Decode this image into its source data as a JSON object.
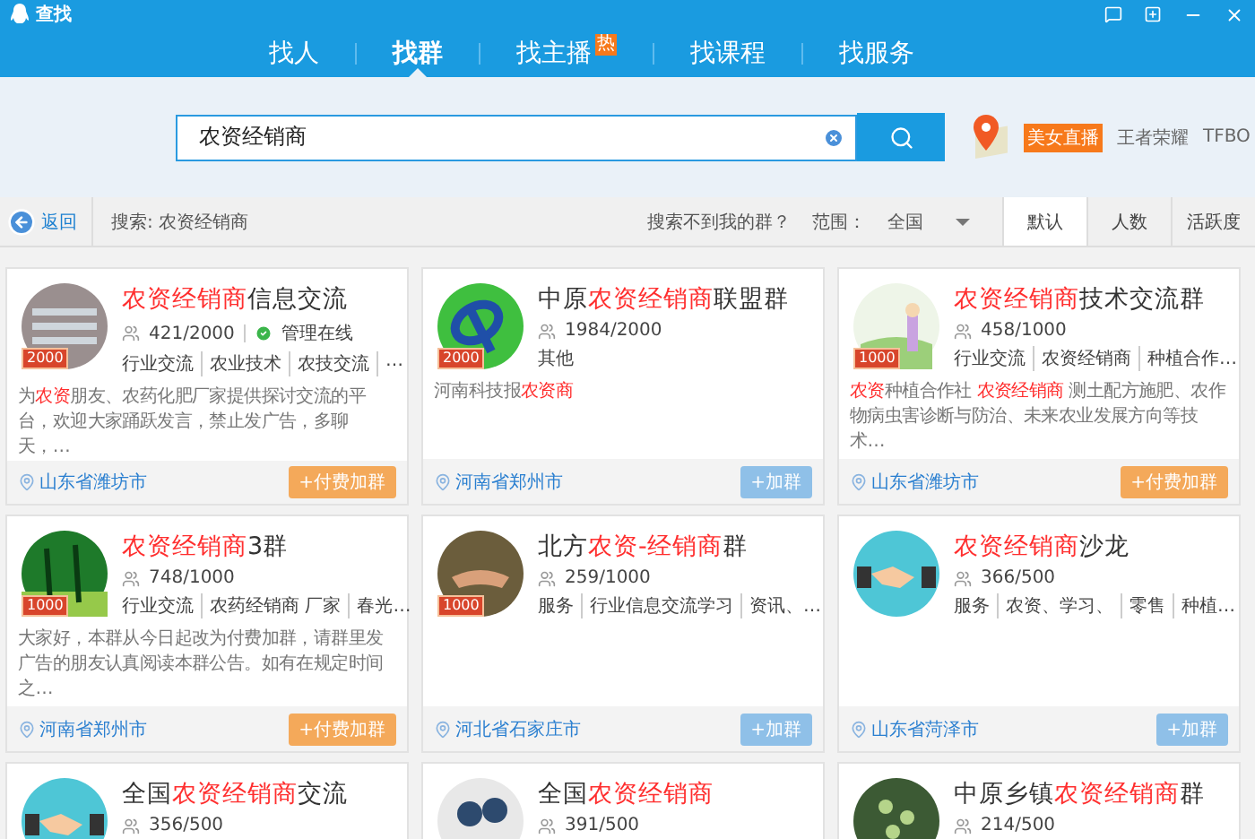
{
  "window": {
    "title": "查找"
  },
  "nav": [
    {
      "label": "找人",
      "selected": false
    },
    {
      "label": "找群",
      "selected": true
    },
    {
      "label": "找主播",
      "selected": false,
      "badge": "热"
    },
    {
      "label": "找课程",
      "selected": false
    },
    {
      "label": "找服务",
      "selected": false
    }
  ],
  "search": {
    "value": "农资经销商"
  },
  "promo": {
    "badge": "美女直播",
    "links": [
      "王者荣耀",
      "TFBO"
    ]
  },
  "toolbar": {
    "back": "返回",
    "query": "搜索: 农资经销商",
    "help": "搜索不到我的群？",
    "range_label": "范围：",
    "range_value": "全国",
    "sorts": [
      {
        "label": "默认",
        "selected": true
      },
      {
        "label": "人数",
        "selected": false
      },
      {
        "label": "活跃度",
        "selected": false
      }
    ]
  },
  "cards": [
    {
      "title": [
        {
          "text": "农资经销商",
          "highlight": true
        },
        {
          "text": "信息交流",
          "highlight": false
        }
      ],
      "avatar": {
        "kind": "photo"
      },
      "badge": "2000",
      "members": "421/2000",
      "status": "管理在线",
      "tags": [
        "行业交流",
        "农业技术",
        "农技交流",
        "…"
      ],
      "desc": [
        {
          "text": "为",
          "highlight": false
        },
        {
          "text": "农资",
          "highlight": true
        },
        {
          "text": "朋友、农药化肥厂家提供探讨交流的平台，欢迎大家踊跃发言，禁止发广告，多聊天，…",
          "highlight": false
        }
      ],
      "location": "山东省潍坊市",
      "join": {
        "kind": "paid",
        "label": "+付费加群"
      }
    },
    {
      "title": [
        {
          "text": "中原",
          "highlight": false
        },
        {
          "text": "农资经销商",
          "highlight": true
        },
        {
          "text": "联盟群",
          "highlight": false
        }
      ],
      "avatar": {
        "kind": "logo"
      },
      "badge": "2000",
      "members": "1984/2000",
      "tags": [
        "其他"
      ],
      "desc": [
        {
          "text": "河南科技报",
          "highlight": false
        },
        {
          "text": "农资商",
          "highlight": true
        }
      ],
      "location": "河南省郑州市",
      "join": {
        "kind": "free",
        "label": "+加群"
      }
    },
    {
      "title": [
        {
          "text": "农资经销商",
          "highlight": true
        },
        {
          "text": "技术交流群",
          "highlight": false
        }
      ],
      "avatar": {
        "kind": "cartoon"
      },
      "badge": "1000",
      "members": "458/1000",
      "tags": [
        "行业交流",
        "农资经销商",
        "种植合作…"
      ],
      "desc": [
        {
          "text": "农资",
          "highlight": true
        },
        {
          "text": "种植合作社 ",
          "highlight": false
        },
        {
          "text": "农资经销商",
          "highlight": true
        },
        {
          "text": " 测土配方施肥、农作物病虫害诊断与防治、未来农业发展方向等技术…",
          "highlight": false
        }
      ],
      "location": "山东省潍坊市",
      "join": {
        "kind": "paid",
        "label": "+付费加群"
      }
    },
    {
      "title": [
        {
          "text": "农资经销商",
          "highlight": true
        },
        {
          "text": "3群",
          "highlight": false
        }
      ],
      "avatar": {
        "kind": "palm"
      },
      "badge": "1000",
      "members": "748/1000",
      "tags": [
        "行业交流",
        "农药经销商 厂家",
        "春光…"
      ],
      "desc": [
        {
          "text": "大家好，本群从今日起改为付费加群，请群里发广告的朋友认真阅读本群公告。如有在规定时间之…",
          "highlight": false
        }
      ],
      "location": "河南省郑州市",
      "join": {
        "kind": "paid",
        "label": "+付费加群"
      }
    },
    {
      "title": [
        {
          "text": "北方",
          "highlight": false
        },
        {
          "text": "农资-经销商",
          "highlight": true
        },
        {
          "text": "群",
          "highlight": false
        }
      ],
      "avatar": {
        "kind": "handshake-photo"
      },
      "badge": "1000",
      "members": "259/1000",
      "tags": [
        "服务",
        "行业信息交流学习",
        "资讯、…"
      ],
      "location": "河北省石家庄市",
      "join": {
        "kind": "free",
        "label": "+加群"
      }
    },
    {
      "title": [
        {
          "text": "农资经销商",
          "highlight": true
        },
        {
          "text": "沙龙",
          "highlight": false
        }
      ],
      "avatar": {
        "kind": "handshake"
      },
      "members": "366/500",
      "tags": [
        "服务",
        "农资、学习、",
        "零售",
        "种植…"
      ],
      "location": "山东省菏泽市",
      "join": {
        "kind": "free",
        "label": "+加群"
      }
    },
    {
      "title": [
        {
          "text": "全国",
          "highlight": false
        },
        {
          "text": "农资经销商",
          "highlight": true
        },
        {
          "text": "交流",
          "highlight": false
        }
      ],
      "avatar": {
        "kind": "handshake"
      },
      "members": "356/500"
    },
    {
      "title": [
        {
          "text": "全国",
          "highlight": false
        },
        {
          "text": "农资经销商",
          "highlight": true
        }
      ],
      "avatar": {
        "kind": "people"
      },
      "members": "391/500"
    },
    {
      "title": [
        {
          "text": "中原乡镇",
          "highlight": false
        },
        {
          "text": "农资经销商",
          "highlight": true
        },
        {
          "text": "群",
          "highlight": false
        }
      ],
      "avatar": {
        "kind": "plant"
      },
      "members": "214/500"
    }
  ]
}
